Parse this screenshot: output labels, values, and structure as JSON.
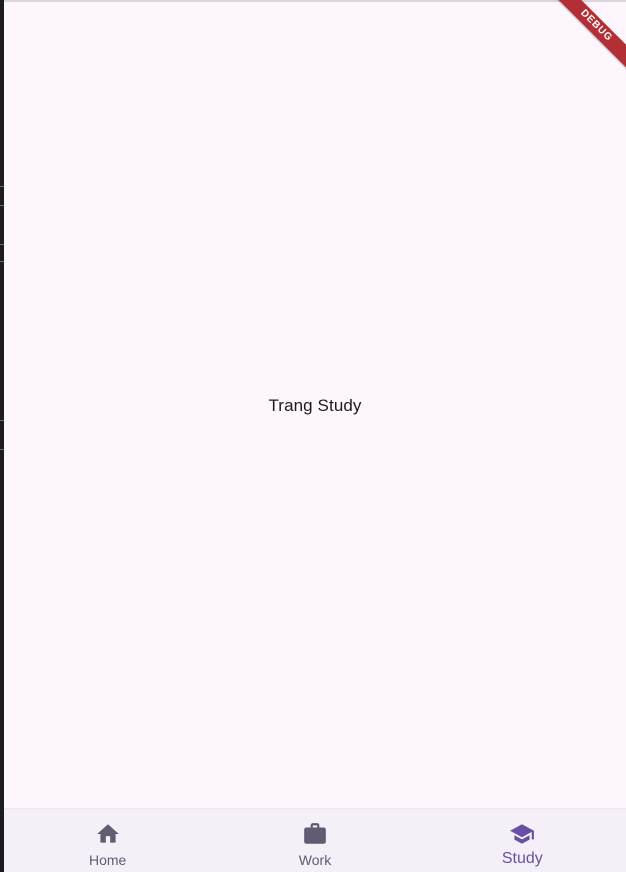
{
  "page": {
    "body_text": "Trang Study"
  },
  "debug_banner": "DEBUG",
  "bottom_nav": {
    "items": [
      {
        "label": "Home",
        "icon": "home-icon",
        "active": false
      },
      {
        "label": "Work",
        "icon": "briefcase-icon",
        "active": false
      },
      {
        "label": "Study",
        "icon": "school-icon",
        "active": true
      }
    ]
  },
  "colors": {
    "background": "#fdf7fd",
    "nav_background": "#f5eff7",
    "active": "#6750a4",
    "inactive": "#625b71",
    "debug_banner": "#b22f35"
  }
}
